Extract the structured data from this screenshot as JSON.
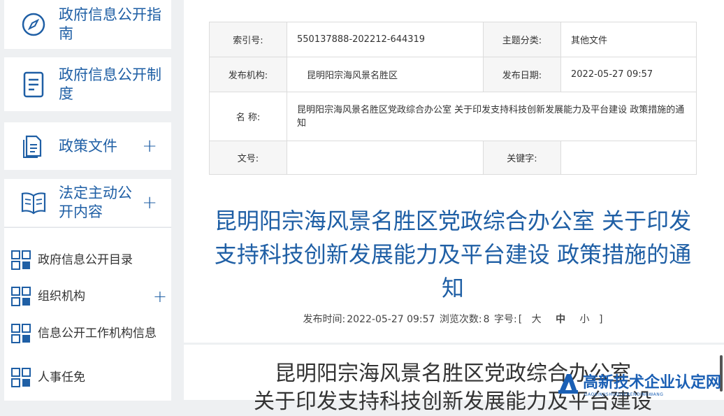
{
  "sidebar": {
    "cards": [
      {
        "label": "政府信息公开指南",
        "icon": "compass-icon"
      },
      {
        "label": "政府信息公开制度",
        "icon": "document-icon"
      },
      {
        "label": "政策文件",
        "icon": "files-icon",
        "plus": "+"
      },
      {
        "label": "法定主动公开内容",
        "icon": "book-icon",
        "plus": "+"
      }
    ],
    "subitems": [
      {
        "label": "政府信息公开目录"
      },
      {
        "label": "组织机构",
        "plus": "+"
      },
      {
        "label": "信息公开工作机构信息"
      },
      {
        "label": "人事任免"
      }
    ]
  },
  "meta": {
    "index_label": "索引号:",
    "index_value": "550137888-202212-644319",
    "topic_label": "主题分类:",
    "topic_value": "其他文件",
    "org_label": "发布机构:",
    "org_value": "昆明阳宗海风景名胜区",
    "date_label": "发布日期:",
    "date_value": "2022-05-27 09:57",
    "name_label": "名 称:",
    "name_value": "昆明阳宗海风景名胜区党政综合办公室 关于印发支持科技创新发展能力及平台建设 政策措施的通知",
    "docno_label": "文号:",
    "docno_value": "",
    "keyword_label": "关键字:",
    "keyword_value": ""
  },
  "article": {
    "title": "昆明阳宗海风景名胜区党政综合办公室 关于印发支持科技创新发展能力及平台建设 政策措施的通知",
    "publish_label": "发布时间:",
    "publish_time": "2022-05-27 09:57",
    "views_label": "浏览次数:",
    "views": "8",
    "font_label": "字号:",
    "font_open": "[",
    "font_large": "大",
    "font_medium": "中",
    "font_small": "小",
    "font_close": "]",
    "doc_heading_1": "昆明阳宗海风景名胜区党政综合办公室",
    "doc_heading_2": "关于印发支持科技创新发展能力及平台建设"
  },
  "watermark": {
    "text": "高新技术企业认定网",
    "sub": "GAOXINJISHUQIYERENDINGWANG"
  },
  "colors": {
    "accent": "#1f5fa5",
    "page_bg": "#eef0f2"
  }
}
